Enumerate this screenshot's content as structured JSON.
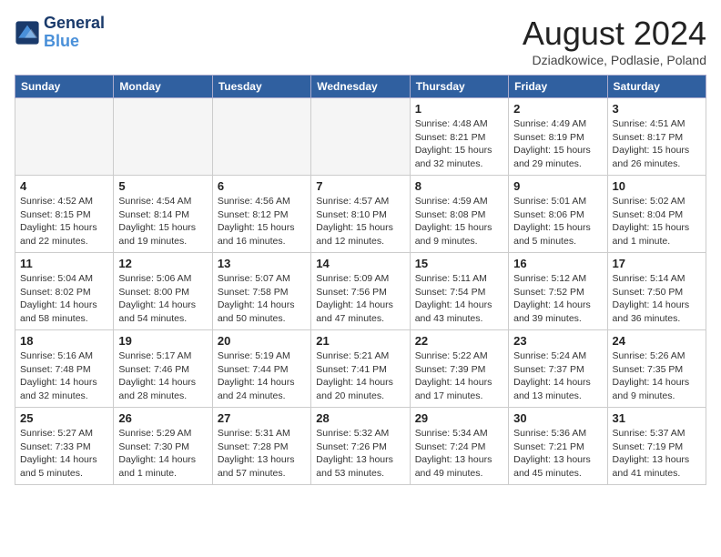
{
  "logo": {
    "line1": "General",
    "line2": "Blue"
  },
  "title": "August 2024",
  "subtitle": "Dziadkowice, Podlasie, Poland",
  "days_of_week": [
    "Sunday",
    "Monday",
    "Tuesday",
    "Wednesday",
    "Thursday",
    "Friday",
    "Saturday"
  ],
  "weeks": [
    [
      {
        "day": "",
        "info": ""
      },
      {
        "day": "",
        "info": ""
      },
      {
        "day": "",
        "info": ""
      },
      {
        "day": "",
        "info": ""
      },
      {
        "day": "1",
        "info": "Sunrise: 4:48 AM\nSunset: 8:21 PM\nDaylight: 15 hours\nand 32 minutes."
      },
      {
        "day": "2",
        "info": "Sunrise: 4:49 AM\nSunset: 8:19 PM\nDaylight: 15 hours\nand 29 minutes."
      },
      {
        "day": "3",
        "info": "Sunrise: 4:51 AM\nSunset: 8:17 PM\nDaylight: 15 hours\nand 26 minutes."
      }
    ],
    [
      {
        "day": "4",
        "info": "Sunrise: 4:52 AM\nSunset: 8:15 PM\nDaylight: 15 hours\nand 22 minutes."
      },
      {
        "day": "5",
        "info": "Sunrise: 4:54 AM\nSunset: 8:14 PM\nDaylight: 15 hours\nand 19 minutes."
      },
      {
        "day": "6",
        "info": "Sunrise: 4:56 AM\nSunset: 8:12 PM\nDaylight: 15 hours\nand 16 minutes."
      },
      {
        "day": "7",
        "info": "Sunrise: 4:57 AM\nSunset: 8:10 PM\nDaylight: 15 hours\nand 12 minutes."
      },
      {
        "day": "8",
        "info": "Sunrise: 4:59 AM\nSunset: 8:08 PM\nDaylight: 15 hours\nand 9 minutes."
      },
      {
        "day": "9",
        "info": "Sunrise: 5:01 AM\nSunset: 8:06 PM\nDaylight: 15 hours\nand 5 minutes."
      },
      {
        "day": "10",
        "info": "Sunrise: 5:02 AM\nSunset: 8:04 PM\nDaylight: 15 hours\nand 1 minute."
      }
    ],
    [
      {
        "day": "11",
        "info": "Sunrise: 5:04 AM\nSunset: 8:02 PM\nDaylight: 14 hours\nand 58 minutes."
      },
      {
        "day": "12",
        "info": "Sunrise: 5:06 AM\nSunset: 8:00 PM\nDaylight: 14 hours\nand 54 minutes."
      },
      {
        "day": "13",
        "info": "Sunrise: 5:07 AM\nSunset: 7:58 PM\nDaylight: 14 hours\nand 50 minutes."
      },
      {
        "day": "14",
        "info": "Sunrise: 5:09 AM\nSunset: 7:56 PM\nDaylight: 14 hours\nand 47 minutes."
      },
      {
        "day": "15",
        "info": "Sunrise: 5:11 AM\nSunset: 7:54 PM\nDaylight: 14 hours\nand 43 minutes."
      },
      {
        "day": "16",
        "info": "Sunrise: 5:12 AM\nSunset: 7:52 PM\nDaylight: 14 hours\nand 39 minutes."
      },
      {
        "day": "17",
        "info": "Sunrise: 5:14 AM\nSunset: 7:50 PM\nDaylight: 14 hours\nand 36 minutes."
      }
    ],
    [
      {
        "day": "18",
        "info": "Sunrise: 5:16 AM\nSunset: 7:48 PM\nDaylight: 14 hours\nand 32 minutes."
      },
      {
        "day": "19",
        "info": "Sunrise: 5:17 AM\nSunset: 7:46 PM\nDaylight: 14 hours\nand 28 minutes."
      },
      {
        "day": "20",
        "info": "Sunrise: 5:19 AM\nSunset: 7:44 PM\nDaylight: 14 hours\nand 24 minutes."
      },
      {
        "day": "21",
        "info": "Sunrise: 5:21 AM\nSunset: 7:41 PM\nDaylight: 14 hours\nand 20 minutes."
      },
      {
        "day": "22",
        "info": "Sunrise: 5:22 AM\nSunset: 7:39 PM\nDaylight: 14 hours\nand 17 minutes."
      },
      {
        "day": "23",
        "info": "Sunrise: 5:24 AM\nSunset: 7:37 PM\nDaylight: 14 hours\nand 13 minutes."
      },
      {
        "day": "24",
        "info": "Sunrise: 5:26 AM\nSunset: 7:35 PM\nDaylight: 14 hours\nand 9 minutes."
      }
    ],
    [
      {
        "day": "25",
        "info": "Sunrise: 5:27 AM\nSunset: 7:33 PM\nDaylight: 14 hours\nand 5 minutes."
      },
      {
        "day": "26",
        "info": "Sunrise: 5:29 AM\nSunset: 7:30 PM\nDaylight: 14 hours\nand 1 minute."
      },
      {
        "day": "27",
        "info": "Sunrise: 5:31 AM\nSunset: 7:28 PM\nDaylight: 13 hours\nand 57 minutes."
      },
      {
        "day": "28",
        "info": "Sunrise: 5:32 AM\nSunset: 7:26 PM\nDaylight: 13 hours\nand 53 minutes."
      },
      {
        "day": "29",
        "info": "Sunrise: 5:34 AM\nSunset: 7:24 PM\nDaylight: 13 hours\nand 49 minutes."
      },
      {
        "day": "30",
        "info": "Sunrise: 5:36 AM\nSunset: 7:21 PM\nDaylight: 13 hours\nand 45 minutes."
      },
      {
        "day": "31",
        "info": "Sunrise: 5:37 AM\nSunset: 7:19 PM\nDaylight: 13 hours\nand 41 minutes."
      }
    ]
  ]
}
